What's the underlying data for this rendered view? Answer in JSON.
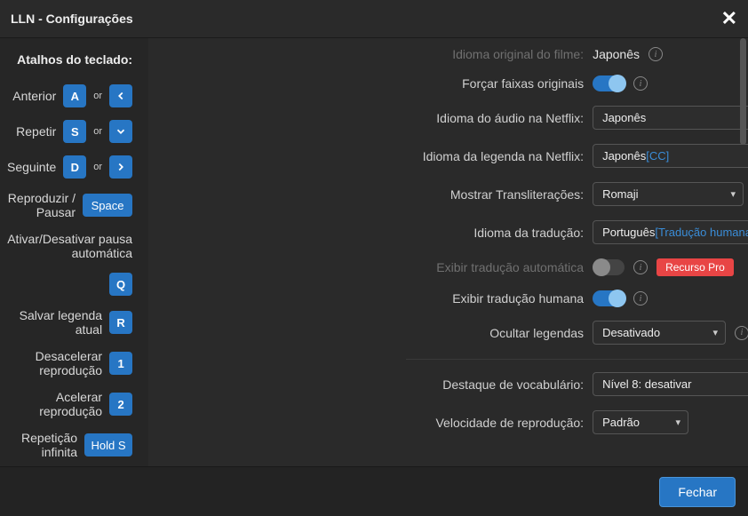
{
  "header": {
    "title": "LLN - Configurações"
  },
  "shortcuts": {
    "title": "Atalhos do teclado:",
    "prev": {
      "label": "Anterior",
      "key1": "A",
      "or": "or"
    },
    "repeat": {
      "label": "Repetir",
      "key1": "S",
      "or": "or"
    },
    "next": {
      "label": "Seguinte",
      "key1": "D",
      "or": "or"
    },
    "playpause": {
      "label": "Reproduzir / Pausar",
      "key1": "Space"
    },
    "autoPause": {
      "label": "Ativar/Desativar pausa automática",
      "key1": "Q"
    },
    "saveSub": {
      "label": "Salvar legenda atual",
      "key1": "R"
    },
    "slowDown": {
      "label": "Desacelerar reprodução",
      "key1": "1"
    },
    "speedUp": {
      "label": "Acelerar reprodução",
      "key1": "2"
    },
    "infinite": {
      "label": "Repetição infinita",
      "key1": "Hold S"
    }
  },
  "settings": {
    "origLang": {
      "label": "Idioma original do filme:",
      "value": "Japonês"
    },
    "forceOrig": {
      "label": "Forçar faixas originais"
    },
    "audioLang": {
      "label": "Idioma do áudio na Netflix:",
      "value": "Japonês"
    },
    "subLang": {
      "label": "Idioma da legenda na Netflix:",
      "value": "Japonês ",
      "cc": "[CC]"
    },
    "translit": {
      "label": "Mostrar Transliterações:",
      "value": "Romaji"
    },
    "transLang": {
      "label": "Idioma da tradução:",
      "value": "Português ",
      "ht": "[Tradução humana]"
    },
    "machineTrans": {
      "label": "Exibir tradução automática",
      "pro": "Recurso Pro"
    },
    "humanTrans": {
      "label": "Exibir tradução humana"
    },
    "hideSubs": {
      "label": "Ocultar legendas",
      "value": "Desativado"
    },
    "vocab": {
      "label": "Destaque de vocabulário:",
      "value": "Nível 8: desativar"
    },
    "speed": {
      "label": "Velocidade de reprodução:",
      "value": "Padrão"
    }
  },
  "footer": {
    "close": "Fechar"
  }
}
